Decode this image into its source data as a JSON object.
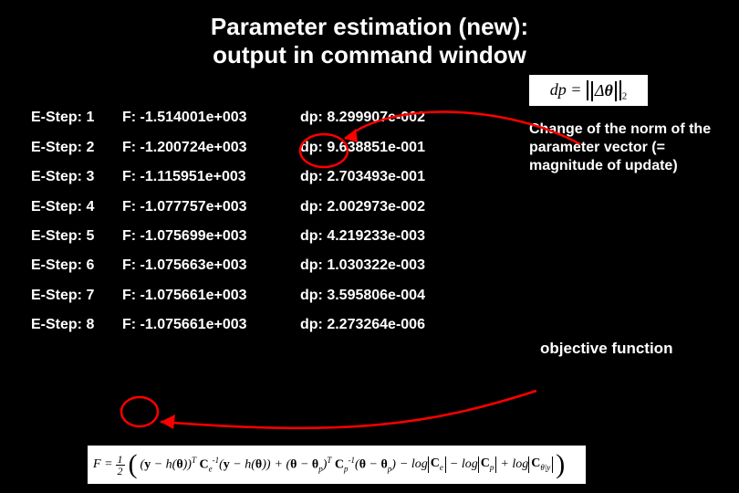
{
  "title_line1": "Parameter estimation (new):",
  "title_line2": "output in command window",
  "step_prefix": "E-Step:",
  "f_prefix": "F:",
  "dp_prefix": "dp:",
  "rows": [
    {
      "step": "1",
      "f": "-1.514001e+003",
      "dp": "8.299907e-002"
    },
    {
      "step": "2",
      "f": "-1.200724e+003",
      "dp": "9.638851e-001"
    },
    {
      "step": "3",
      "f": "-1.115951e+003",
      "dp": "2.703493e-001"
    },
    {
      "step": "4",
      "f": "-1.077757e+003",
      "dp": "2.002973e-002"
    },
    {
      "step": "5",
      "f": "-1.075699e+003",
      "dp": "4.219233e-003"
    },
    {
      "step": "6",
      "f": "-1.075663e+003",
      "dp": "1.030322e-003"
    },
    {
      "step": "7",
      "f": "-1.075661e+003",
      "dp": "3.595806e-004"
    },
    {
      "step": "8",
      "f": "-1.075661e+003",
      "dp": "2.273264e-006"
    }
  ],
  "dp_formula": "dp = ‖Δθ‖₂",
  "side_note": "Change of the norm of the parameter vector (= magnitude of update)",
  "objective_label": "objective function",
  "f_formula_text": "F = ½ ( (y − h(θ))ᵀ C_e⁻¹ (y − h(θ)) + (θ − θ_p)ᵀ C_p⁻¹ (θ − θ_p) − log|C_e| − log|C_p| + log|C_θ|y| )"
}
